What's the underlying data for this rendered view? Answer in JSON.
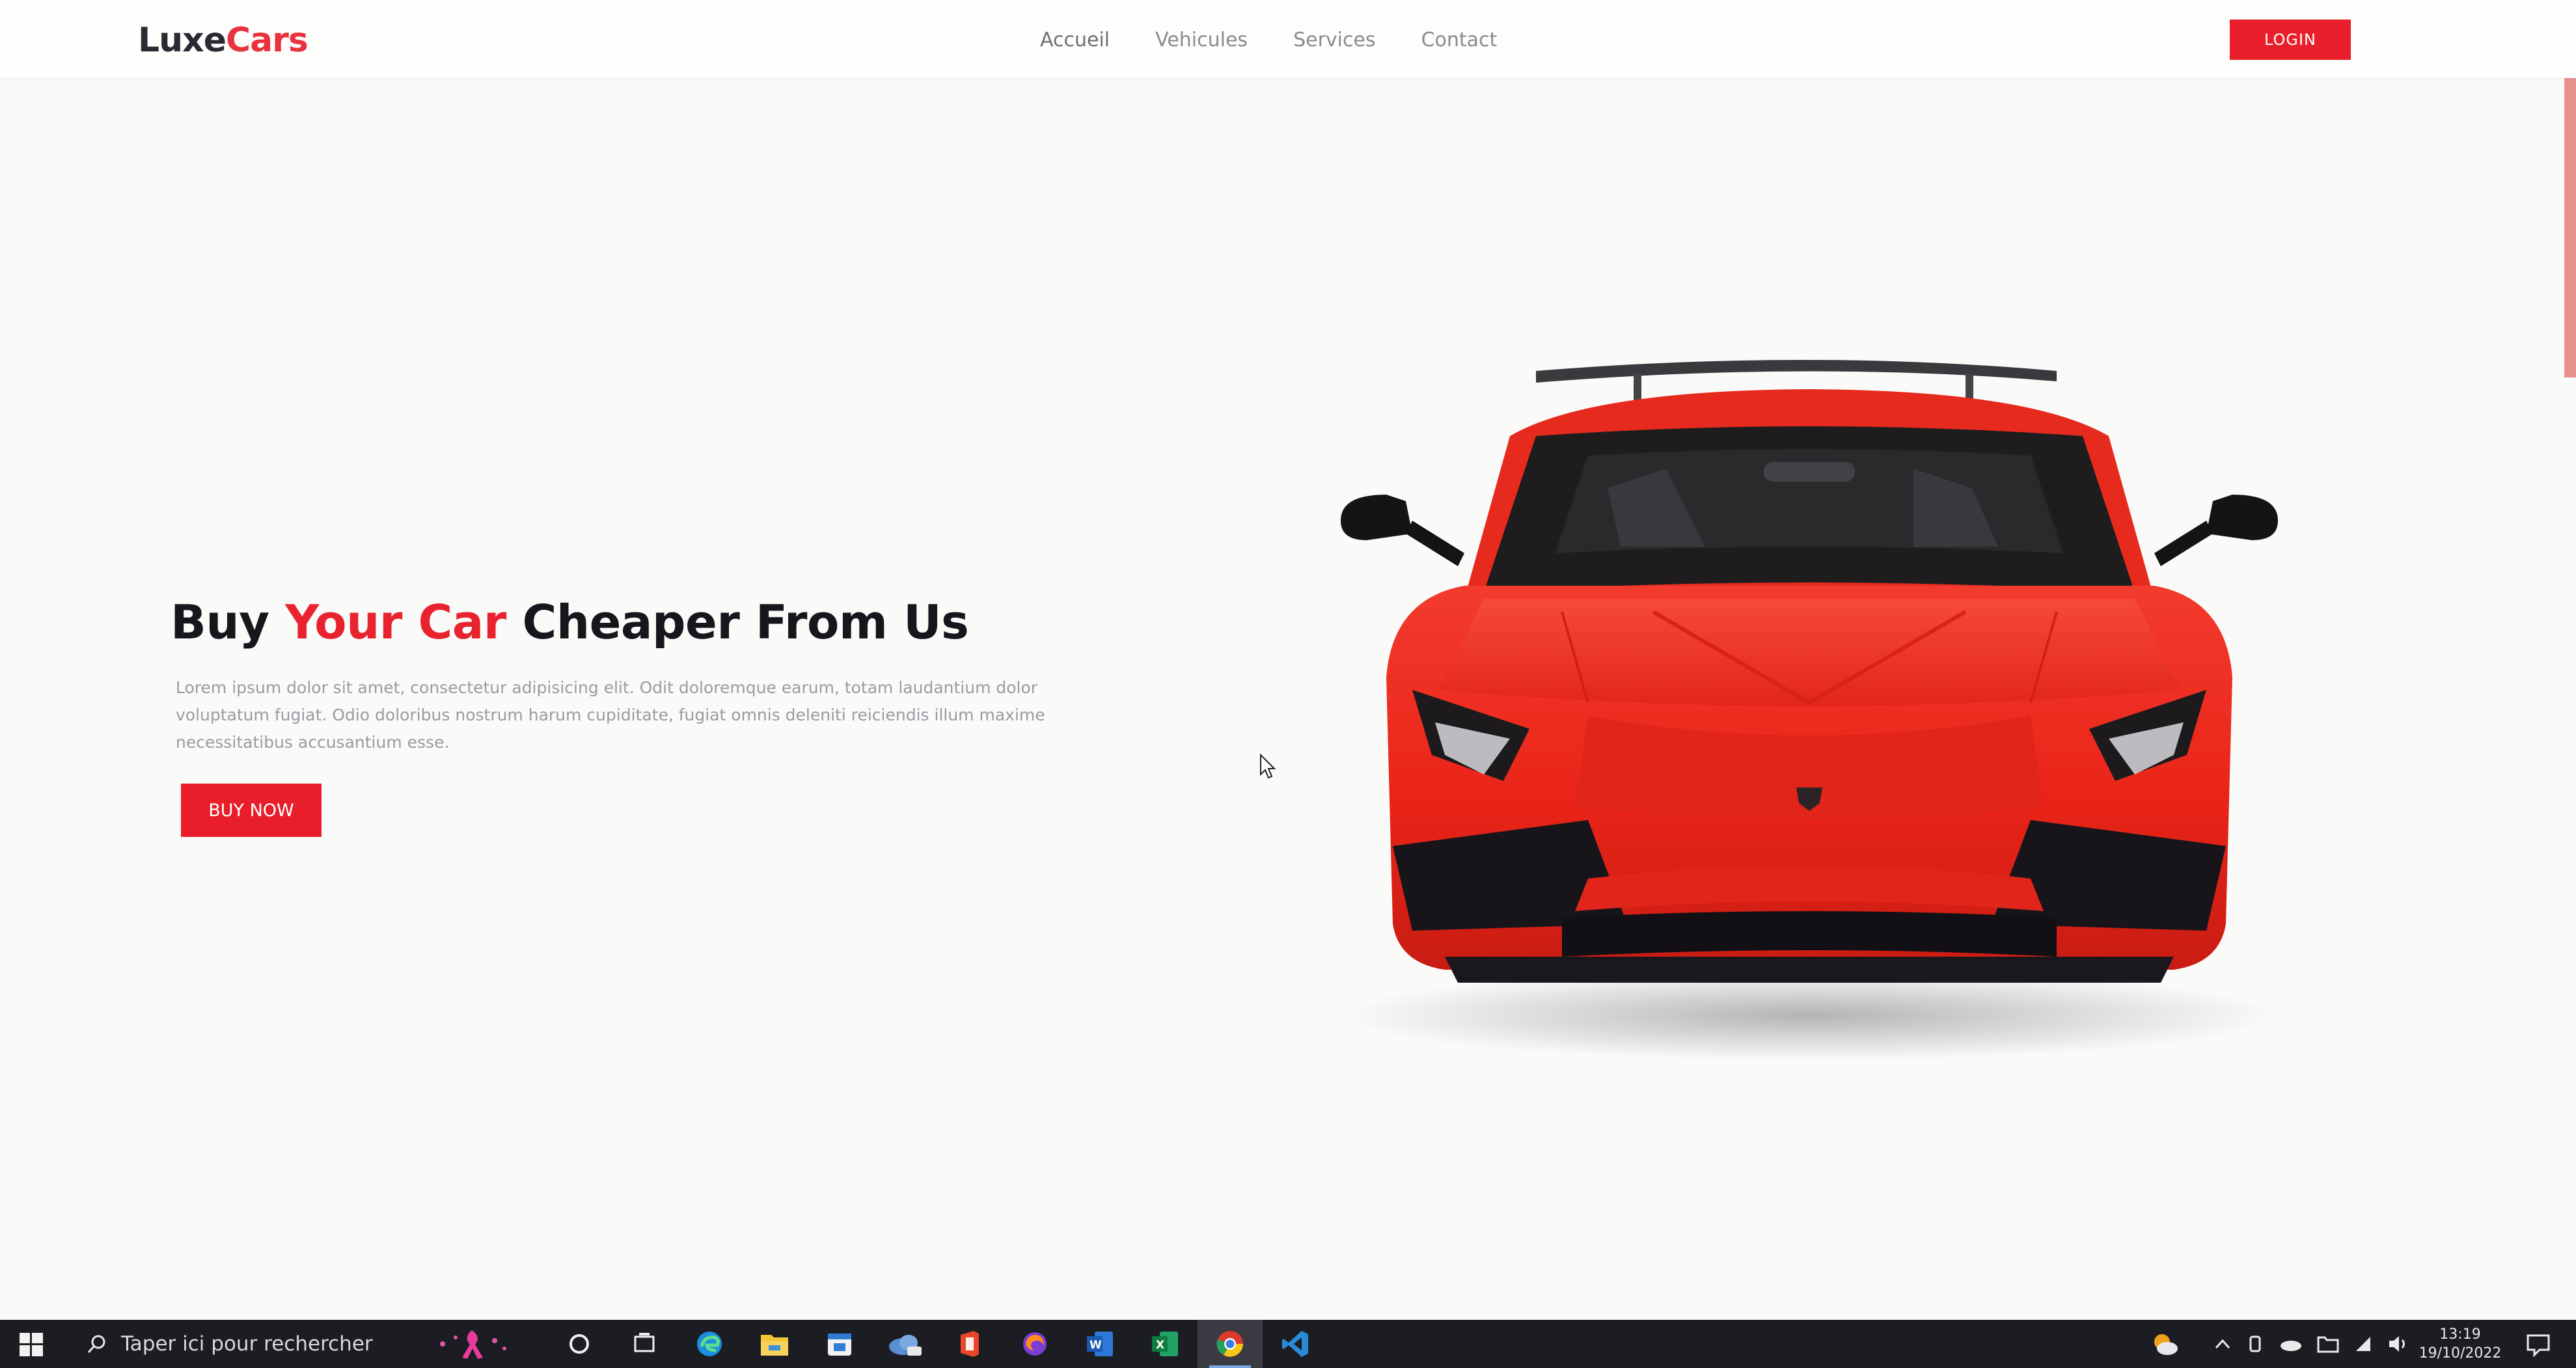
{
  "brand": {
    "name_part1": "Luxe",
    "name_part2": "Cars"
  },
  "nav": {
    "links": [
      "Accueil",
      "Vehicules",
      "Services",
      "Contact"
    ],
    "login_label": "LOGIN"
  },
  "hero": {
    "title_part1": "Buy ",
    "title_accent": "Your Car",
    "title_part2": " Cheaper From Us",
    "description": "Lorem ipsum dolor sit amet, consectetur adipisicing elit. Odit doloremque earum, totam laudantium dolor voluptatum fugiat. Odio doloribus nostrum harum cupiditate, fugiat omnis deleniti reiciendis illum maxime necessitatibus accusantium esse.",
    "cta_label": "BUY NOW"
  },
  "taskbar": {
    "search_placeholder": "Taper ici pour rechercher",
    "apps": [
      "task-view-icon",
      "edge-icon",
      "file-explorer-icon",
      "calendar-icon",
      "weather-app-icon",
      "office-icon",
      "firefox-icon",
      "word-icon",
      "excel-icon",
      "chrome-icon",
      "vscode-icon"
    ],
    "active_app": "chrome-icon",
    "time": "13:19",
    "date": "19/10/2022"
  },
  "colors": {
    "accent": "#e8232f",
    "dark": "#16161c",
    "taskbar": "#1c1d22"
  }
}
